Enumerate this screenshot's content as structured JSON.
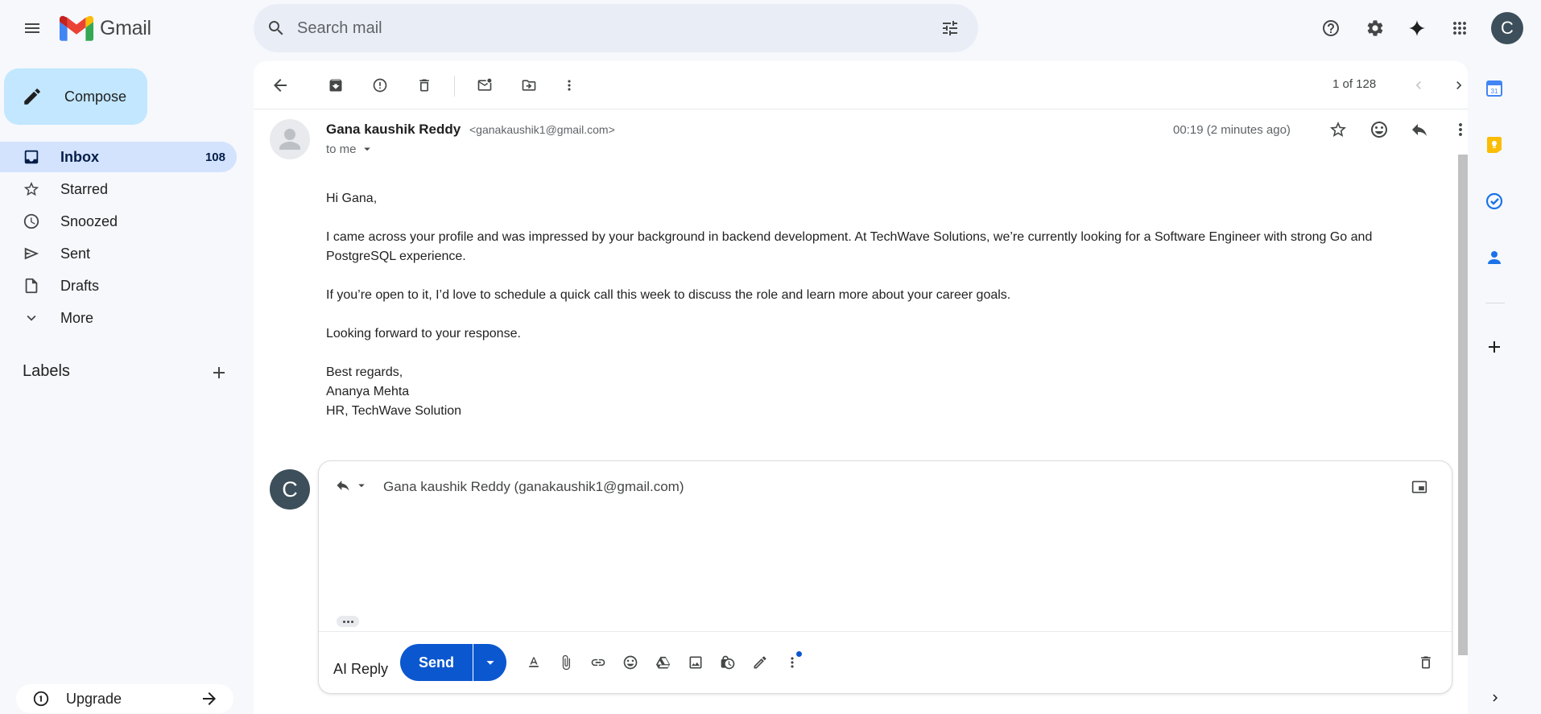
{
  "app": {
    "name": "Gmail"
  },
  "search": {
    "placeholder": "Search mail"
  },
  "account": {
    "initial": "C"
  },
  "nav": {
    "compose_label": "Compose",
    "items": [
      {
        "label": "Inbox",
        "count": "108",
        "icon": "inbox-icon",
        "active": true
      },
      {
        "label": "Starred",
        "count": "",
        "icon": "star-icon"
      },
      {
        "label": "Snoozed",
        "count": "",
        "icon": "clock-icon"
      },
      {
        "label": "Sent",
        "count": "",
        "icon": "send-icon"
      },
      {
        "label": "Drafts",
        "count": "",
        "icon": "draft-icon"
      },
      {
        "label": "More",
        "count": "",
        "icon": "chevron-down-icon"
      }
    ],
    "labels_heading": "Labels",
    "upgrade_label": "Upgrade"
  },
  "toolbar": {
    "pager": "1 of 128"
  },
  "message": {
    "sender_name": "Gana kaushik Reddy",
    "sender_email": "<ganakaushik1@gmail.com>",
    "to_label": "to me",
    "timestamp": "00:19 (2 minutes ago)",
    "body": {
      "greeting": "Hi Gana,",
      "p1": "I came across your profile and was impressed by your background in backend development. At TechWave Solutions, we’re currently looking for a Software Engineer with strong Go and PostgreSQL experience.",
      "p2": "If you’re open to it, I’d love to schedule a quick call this week to discuss the role and learn more about your career goals.",
      "p3": "Looking forward to your response.",
      "sig1": "Best regards,",
      "sig2": "Ananya Mehta",
      "sig3": "HR, TechWave Solution"
    }
  },
  "reply": {
    "avatar_initial": "C",
    "recipient": "Gana kaushik Reddy (ganakaushik1@gmail.com)",
    "ai_reply_label": "AI Reply",
    "send_label": "Send"
  },
  "colors": {
    "accent": "#0b57d0",
    "compose_bg": "#c2e7ff",
    "active_nav_bg": "#d3e3fd",
    "app_bg": "#f6f8fc"
  }
}
